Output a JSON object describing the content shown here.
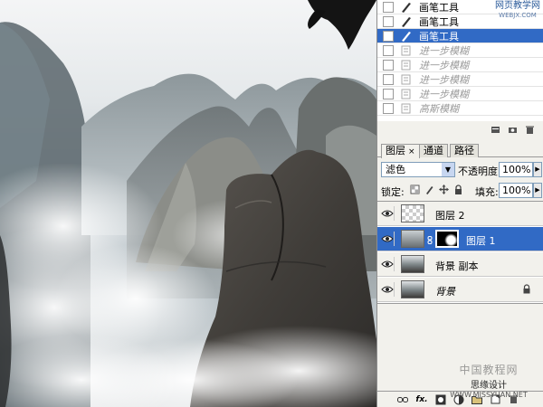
{
  "history": {
    "items": [
      {
        "label": "画笔工具",
        "state": "normal",
        "icon": "brush-icon"
      },
      {
        "label": "画笔工具",
        "state": "normal",
        "icon": "brush-icon"
      },
      {
        "label": "画笔工具",
        "state": "active",
        "icon": "brush-icon"
      },
      {
        "label": "进一步模糊",
        "state": "dim",
        "icon": "filter-icon"
      },
      {
        "label": "进一步模糊",
        "state": "dim",
        "icon": "filter-icon"
      },
      {
        "label": "进一步模糊",
        "state": "dim",
        "icon": "filter-icon"
      },
      {
        "label": "进一步模糊",
        "state": "dim",
        "icon": "filter-icon"
      },
      {
        "label": "高斯模糊",
        "state": "dim",
        "icon": "filter-icon"
      }
    ],
    "watermark_line1": "网页教学网",
    "watermark_line2": "WEBJX.COM"
  },
  "layers_panel": {
    "tabs": [
      {
        "label": "图层",
        "close": "×",
        "active": true
      },
      {
        "label": "通道",
        "active": false
      },
      {
        "label": "路径",
        "active": false
      }
    ],
    "blend_mode": "滤色",
    "opacity_label": "不透明度:",
    "opacity_value": "100%",
    "lock_label": "锁定:",
    "fill_label": "填充:",
    "fill_value": "100%",
    "layers": [
      {
        "name": "图层 2",
        "active": false,
        "locked": false,
        "has_mask": false
      },
      {
        "name": "图层 1",
        "active": true,
        "locked": false,
        "has_mask": true
      },
      {
        "name": "背景 副本",
        "active": false,
        "locked": false,
        "has_mask": false
      },
      {
        "name": "背景",
        "active": false,
        "locked": true,
        "has_mask": false
      }
    ],
    "bottom_bar": {
      "fx_label": "fx."
    }
  },
  "watermark_bottom": {
    "main": "中国教程网",
    "line_a": "思缘设计",
    "line_b": "WWW.MISSYUAN.NET"
  },
  "colors": {
    "selection": "#316ac5",
    "panel_bg": "#f2f1ec",
    "sky": "#eef0f1",
    "rock_dark": "#3f3d3a",
    "mountain": "#7c8486"
  }
}
